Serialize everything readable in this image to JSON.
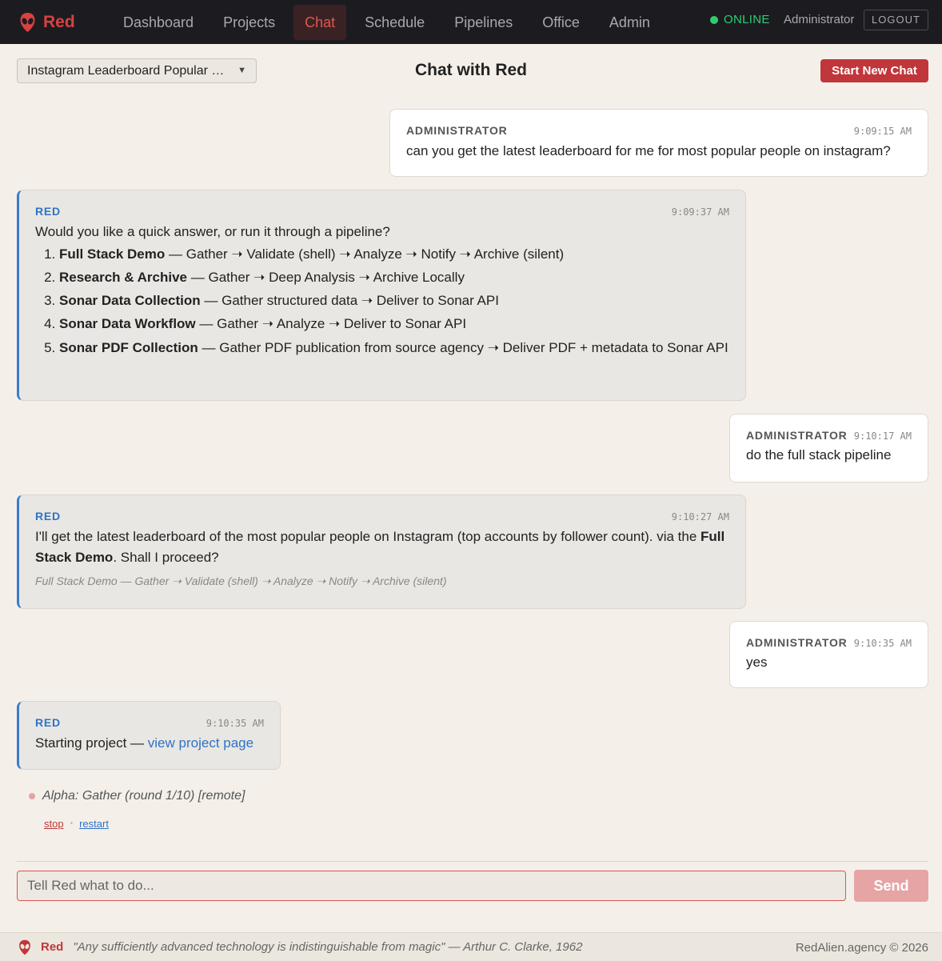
{
  "brand": {
    "name": "Red",
    "logo_icon": "alien-head-icon",
    "accent": "#d94141"
  },
  "nav": {
    "items": [
      {
        "label": "Dashboard",
        "active": false
      },
      {
        "label": "Projects",
        "active": false
      },
      {
        "label": "Chat",
        "active": true
      },
      {
        "label": "Schedule",
        "active": false
      },
      {
        "label": "Pipelines",
        "active": false
      },
      {
        "label": "Office",
        "active": false
      },
      {
        "label": "Admin",
        "active": false
      }
    ],
    "status": "ONLINE",
    "status_color": "#2ecc71",
    "user": "Administrator",
    "logout": "LOGOUT"
  },
  "header": {
    "selected_chat": "Instagram Leaderboard Popular People",
    "title": "Chat with Red",
    "new_chat": "Start New Chat"
  },
  "messages": [
    {
      "role": "user",
      "author": "ADMINISTRATOR",
      "time": "9:09:15 AM",
      "text": "can you get the latest leaderboard for me for most popular people on instagram?"
    },
    {
      "role": "bot",
      "author": "RED",
      "time": "9:09:37 AM",
      "text": "Would you like a quick answer, or run it through a pipeline?",
      "options": [
        {
          "name": "Full Stack Demo",
          "steps": "— Gather ➝ Validate (shell) ➝ Analyze ➝ Notify ➝ Archive (silent)"
        },
        {
          "name": "Research & Archive",
          "steps": "— Gather ➝ Deep Analysis ➝ Archive Locally"
        },
        {
          "name": "Sonar Data Collection",
          "steps": "— Gather structured data ➝ Deliver to Sonar API"
        },
        {
          "name": "Sonar Data Workflow",
          "steps": "— Gather ➝ Analyze ➝ Deliver to Sonar API"
        },
        {
          "name": "Sonar PDF Collection",
          "steps": "— Gather PDF publication from source agency ➝ Deliver PDF + metadata to Sonar API"
        }
      ]
    },
    {
      "role": "user",
      "author": "ADMINISTRATOR",
      "time": "9:10:17 AM",
      "text": "do the full stack pipeline"
    },
    {
      "role": "bot",
      "author": "RED",
      "time": "9:10:27 AM",
      "text_before": "I'll get the latest leaderboard of the most popular people on Instagram (top accounts by follower count). via the ",
      "text_bold": "Full Stack Demo",
      "text_after": ". Shall I proceed?",
      "note": "Full Stack Demo — Gather ➝ Validate (shell) ➝ Analyze ➝ Notify ➝ Archive (silent)"
    },
    {
      "role": "user",
      "author": "ADMINISTRATOR",
      "time": "9:10:35 AM",
      "text": "yes"
    },
    {
      "role": "bot",
      "author": "RED",
      "time": "9:10:35 AM",
      "text": "Starting project — ",
      "link": "view project page"
    }
  ],
  "progress": {
    "text": "Alpha: Gather (round 1/10) [remote]",
    "stop": "stop",
    "restart": "restart"
  },
  "composer": {
    "placeholder": "Tell Red what to do...",
    "send": "Send"
  },
  "footer": {
    "brand": "Red",
    "quote": "\"Any sufficiently advanced technology is indistinguishable from magic\" — Arthur C. Clarke, 1962",
    "copyright": "RedAlien.agency © 2026"
  }
}
